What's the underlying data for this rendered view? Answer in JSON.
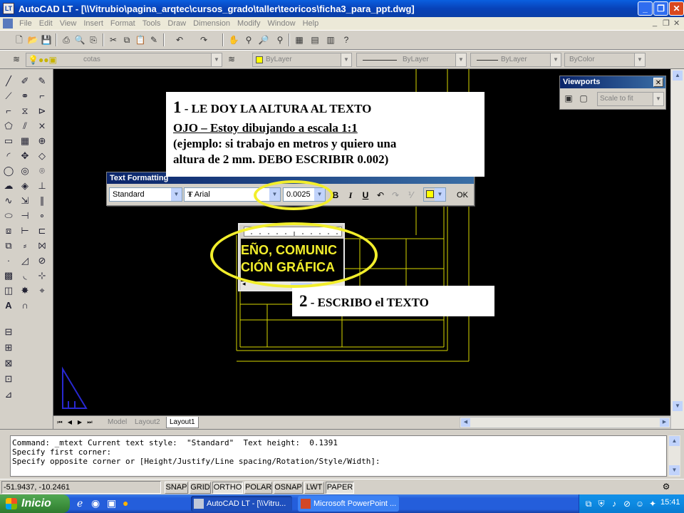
{
  "window": {
    "title": "AutoCAD LT - [\\\\Vitrubio\\pagina_arqtec\\cursos_grado\\taller\\teoricos\\ficha3_para_ppt.dwg]",
    "app_icon_text": "LT",
    "minimize": "_",
    "restore": "❐",
    "close": "✕"
  },
  "menu": [
    "File",
    "Edit",
    "View",
    "Insert",
    "Format",
    "Tools",
    "Draw",
    "Dimension",
    "Modify",
    "Window",
    "Help"
  ],
  "doc_controls": {
    "minimize": "_",
    "restore": "❐",
    "close": "✕"
  },
  "layers_toolbar": {
    "layer_value": "cotas"
  },
  "properties_toolbar": {
    "color": "ByLayer",
    "linetype": "ByLayer",
    "lineweight": "ByLayer",
    "plotstyle": "ByColor"
  },
  "viewports": {
    "title": "Viewports",
    "scale": "Scale to fit",
    "close": "✕"
  },
  "text_formatting": {
    "title": "Text Formatting",
    "style": "Standard",
    "font": "Arial",
    "height": "0.0025",
    "bold": "B",
    "italic": "I",
    "underline": "U",
    "ok": "OK",
    "font_prefix": "Ŧ"
  },
  "mtext_editor": {
    "line1": "EÑO, COMUNIC",
    "line2": "CIÓN GRÁFICA"
  },
  "notes": {
    "note1": {
      "number": "1",
      "title": " - LE DOY LA ALTURA AL TEXTO",
      "line2": "OJO – Estoy dibujando a escala 1:1",
      "line3": "(ejemplo: si trabajo en metros y quiero una",
      "line4": "altura de 2 mm. DEBO ESCRIBIR 0.002)"
    },
    "note2": {
      "number": "2",
      "title": " - ESCRIBO el TEXTO"
    }
  },
  "layout_tabs": [
    {
      "label": "Model",
      "active": false
    },
    {
      "label": "Layout2",
      "active": false
    },
    {
      "label": "Layout1",
      "active": true
    }
  ],
  "command_lines": [
    "Command: _mtext Current text style:  \"Standard\"  Text height:  0.1391",
    "Specify first corner:",
    "Specify opposite corner or [Height/Justify/Line spacing/Rotation/Style/Width]:"
  ],
  "status": {
    "coords": "-51.9437, -10.2461",
    "buttons": [
      {
        "label": "SNAP",
        "pressed": false
      },
      {
        "label": "GRID",
        "pressed": false
      },
      {
        "label": "ORTHO",
        "pressed": true
      },
      {
        "label": "POLAR",
        "pressed": false
      },
      {
        "label": "OSNAP",
        "pressed": false
      },
      {
        "label": "LWT",
        "pressed": false
      },
      {
        "label": "PAPER",
        "pressed": true
      }
    ]
  },
  "taskbar": {
    "start": "Inicio",
    "tasks": [
      {
        "label": "AutoCAD LT - [\\\\Vitru...",
        "active": true
      },
      {
        "label": "Microsoft PowerPoint ...",
        "active": false
      }
    ],
    "clock": "15:41"
  },
  "colors": {
    "annotation_oval": "#f2ee2b",
    "drawing_lines": "#d8d800",
    "ucs_icon": "#2828d0",
    "titlebar": "#0a5fe0"
  }
}
